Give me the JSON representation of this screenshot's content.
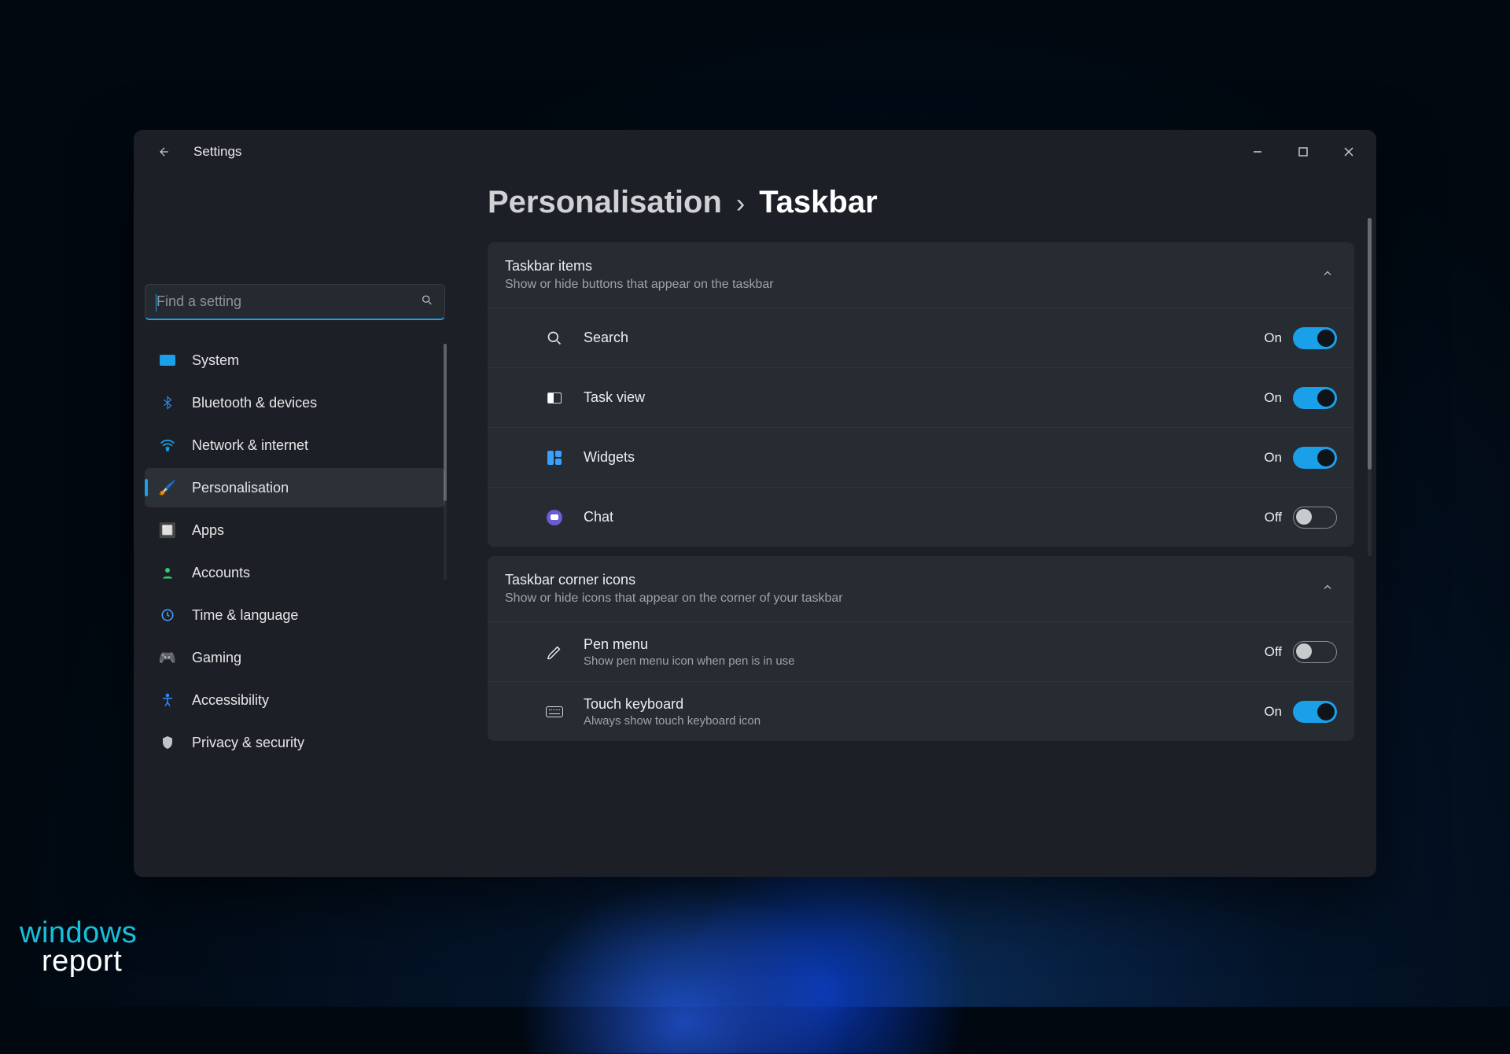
{
  "window": {
    "title": "Settings"
  },
  "search": {
    "placeholder": "Find a setting"
  },
  "sidebar": {
    "items": [
      {
        "label": "System"
      },
      {
        "label": "Bluetooth & devices"
      },
      {
        "label": "Network & internet"
      },
      {
        "label": "Personalisation"
      },
      {
        "label": "Apps"
      },
      {
        "label": "Accounts"
      },
      {
        "label": "Time & language"
      },
      {
        "label": "Gaming"
      },
      {
        "label": "Accessibility"
      },
      {
        "label": "Privacy & security"
      }
    ]
  },
  "breadcrumb": {
    "parent": "Personalisation",
    "separator": "›",
    "current": "Taskbar"
  },
  "sections": {
    "taskbar_items": {
      "title": "Taskbar items",
      "subtitle": "Show or hide buttons that appear on the taskbar",
      "rows": [
        {
          "label": "Search",
          "state": "On"
        },
        {
          "label": "Task view",
          "state": "On"
        },
        {
          "label": "Widgets",
          "state": "On"
        },
        {
          "label": "Chat",
          "state": "Off"
        }
      ]
    },
    "corner_icons": {
      "title": "Taskbar corner icons",
      "subtitle": "Show or hide icons that appear on the corner of your taskbar",
      "rows": [
        {
          "label": "Pen menu",
          "sub": "Show pen menu icon when pen is in use",
          "state": "Off"
        },
        {
          "label": "Touch keyboard",
          "sub": "Always show touch keyboard icon",
          "state": "On"
        }
      ]
    }
  },
  "watermark": {
    "line1": "windows",
    "line2": "report"
  }
}
